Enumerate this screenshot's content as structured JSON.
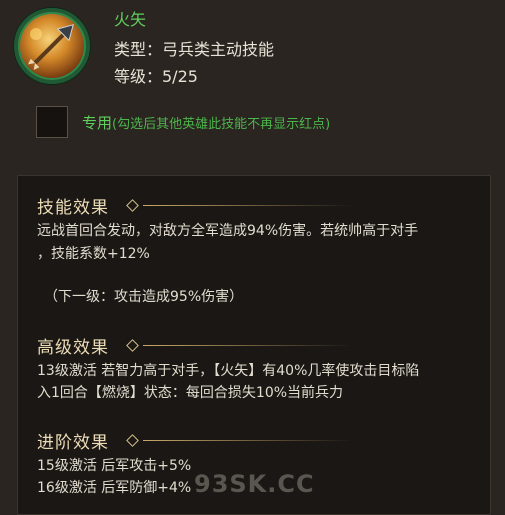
{
  "skill": {
    "name": "火矢",
    "type": "类型：弓兵类主动技能",
    "level": "等级：5/25",
    "icon": "fire-arrow-icon"
  },
  "dedicated": {
    "label": "专用",
    "note": "(勾选后其他英雄此技能不再显示红点)",
    "checked": false
  },
  "sections": {
    "effect": {
      "title": "技能效果",
      "line1": "远战首回合发动，对敌方全军造成94%伤害。若统帅高于对手",
      "line2": "，技能系数+12%",
      "next": "（下一级：攻击造成95%伤害）"
    },
    "advanced": {
      "title": "高级效果",
      "line1": "13级激活 若智力高于对手，【火矢】有40%几率使攻击目标陷",
      "line2": "入1回合【燃烧】状态：每回合损失10%当前兵力"
    },
    "promote": {
      "title": "进阶效果",
      "line1": "15级激活 后军攻击+5%",
      "line2": "16级激活 后军防御+4%"
    }
  },
  "watermark": "93SK.CC"
}
